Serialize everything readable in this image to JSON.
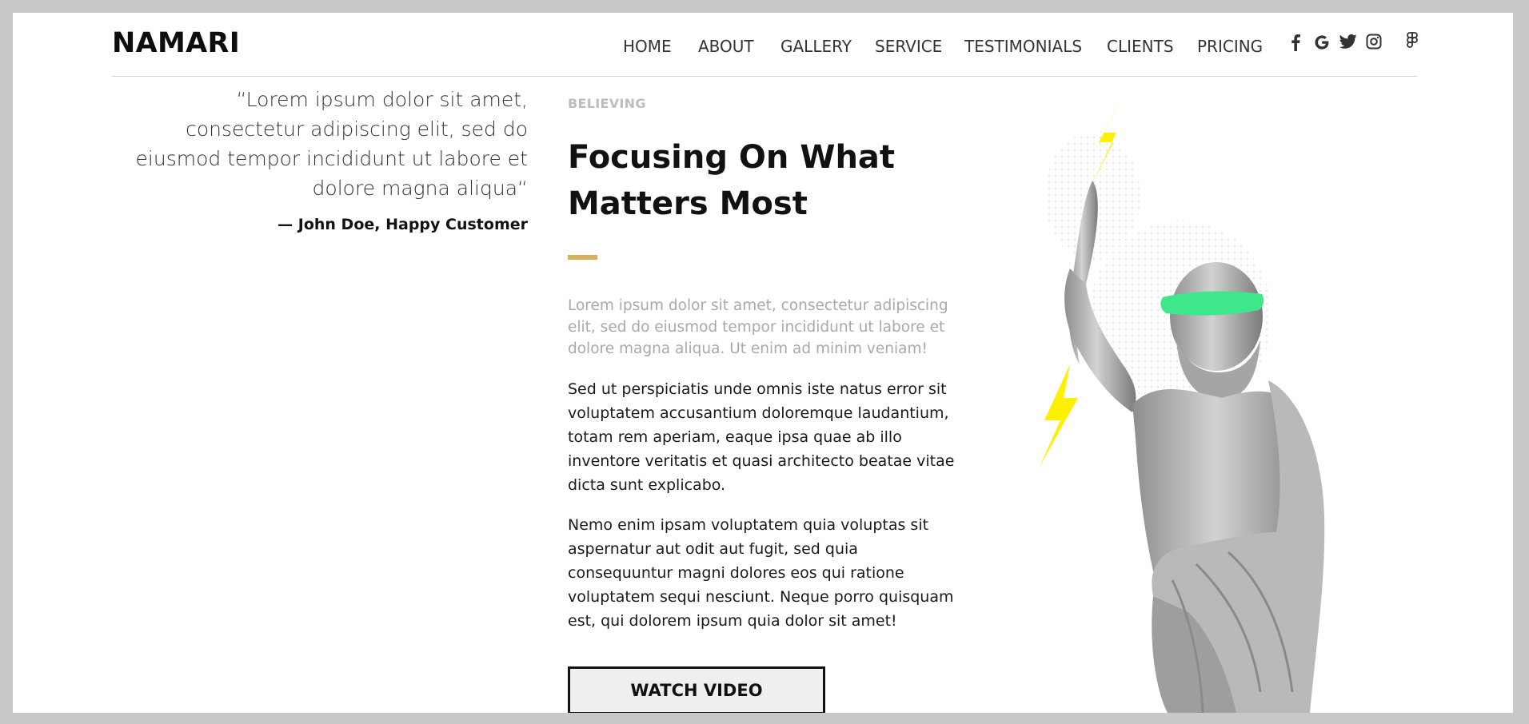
{
  "header": {
    "logo": "NAMARI",
    "nav": [
      {
        "label": "HOME"
      },
      {
        "label": "ABOUT"
      },
      {
        "label": "GALLERY"
      },
      {
        "label": "SERVICE"
      },
      {
        "label": "TESTIMONIALS"
      },
      {
        "label": "CLIENTS"
      },
      {
        "label": "PRICING"
      }
    ],
    "social_icons": [
      "facebook-icon",
      "google-icon",
      "twitter-icon",
      "instagram-icon",
      "figma-icon"
    ]
  },
  "testimonial": {
    "quote": "“Lorem ipsum dolor sit amet, consectetur adipiscing elit, sed do eiusmod tempor incididunt ut labore et dolore magna aliqua“",
    "author": "— John Doe, Happy Customer"
  },
  "feature": {
    "eyebrow": "BELIEVING",
    "title": "Focusing On What Matters Most",
    "lead": "Lorem ipsum dolor sit amet, consectetur adipiscing elit, sed do eiusmod tempor incididunt ut labore et dolore magna aliqua. Ut enim ad minim veniam!",
    "paragraph1": "Sed ut perspiciatis unde omnis iste natus error sit voluptatem accusantium doloremque laudantium, totam rem aperiam, eaque ipsa quae ab illo inventore veritatis et quasi architecto beatae vitae dicta sunt explicabo.",
    "paragraph2": "Nemo enim ipsam voluptatem quia voluptas sit aspernatur aut odit aut fugit, sed quia consequuntur magni dolores eos qui ratione voluptatem sequi nesciunt. Neque porro quisquam est, qui dolorem ipsum quia dolor sit amet!",
    "cta_label": "WATCH VIDEO"
  },
  "colors": {
    "accent": "#d4b15a",
    "lightning": "#ffef00",
    "eye_stripe": "#3ee88a"
  }
}
